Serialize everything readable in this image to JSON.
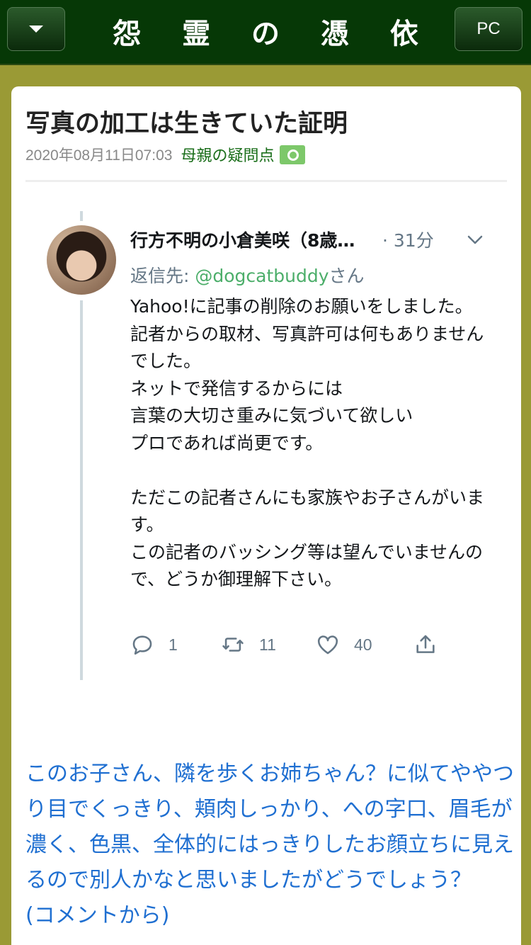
{
  "header": {
    "menu_icon": "chevron-down-icon",
    "site_title": "怨 霊 の 憑 依",
    "pc_label": "PC"
  },
  "article": {
    "title": "写真の加工は生きていた証明",
    "date": "2020年08月11日07:03",
    "category": "母親の疑問点",
    "category_icon": "camera-icon"
  },
  "tweet": {
    "name": "行方不明の小倉美咲（8歳…",
    "time": "· 31分",
    "reply_label": "返信先: ",
    "reply_handle": "@dogcatbuddy",
    "reply_suffix": "さん",
    "body": "Yahoo!に記事の削除のお願いをしました。\n記者からの取材、写真許可は何もありませんでした。\nネットで発信するからには\n言葉の大切さ重みに気づいて欲しい\nプロであれば尚更です。\n\nただこの記者さんにも家族やお子さんがいます。\nこの記者のバッシング等は望んでいませんので、どうか御理解下さい。",
    "replies": "1",
    "retweets": "11",
    "likes": "40"
  },
  "comment": "このお子さん、隣を歩くお姉ちゃん？に似てややつり目でくっきり、頬肉しっかり、への字口、眉毛が濃く、色黒、全体的にはっきりしたお顔立ちに見えるので別人かなと思いましたがどうでしょう？　(コメントから)",
  "colors": {
    "header_bg": "#063806",
    "page_bg": "#9a9a35",
    "link_blue": "#1f6fd1",
    "category_green": "#1a6e1a",
    "handle_green": "#4cae6a"
  }
}
